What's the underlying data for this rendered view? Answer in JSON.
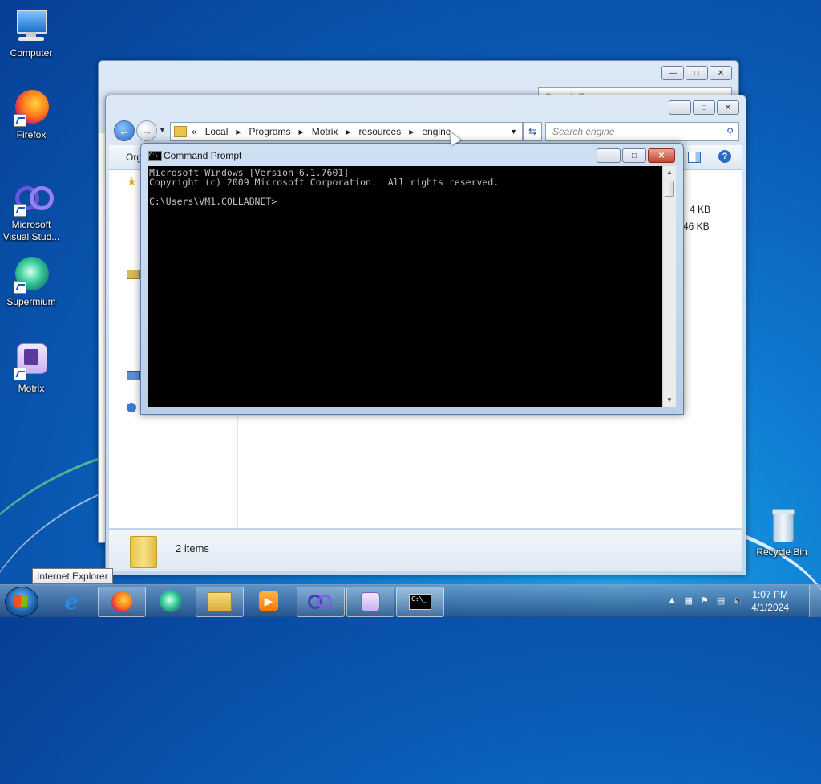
{
  "desktop": {
    "icons": [
      {
        "label": "Computer"
      },
      {
        "label": "Firefox"
      },
      {
        "label": "Microsoft Visual Stud..."
      },
      {
        "label": "Supermium"
      },
      {
        "label": "Motrix"
      },
      {
        "label": "Recycle Bin"
      }
    ]
  },
  "explorer_back": {
    "search_placeholder": "Search Resources"
  },
  "explorer": {
    "breadcrumb_chevron": "«",
    "path": [
      "Local",
      "Programs",
      "Motrix",
      "resources",
      "engine"
    ],
    "search_placeholder": "Search engine",
    "toolbar_organize": "Org",
    "file_sizes": [
      "4 KB",
      "46 KB"
    ],
    "status_items": "2 items"
  },
  "cmd": {
    "title": "Command Prompt",
    "line1": "Microsoft Windows [Version 6.1.7601]",
    "line2": "Copyright (c) 2009 Microsoft Corporation.  All rights reserved.",
    "line3": "",
    "line4": "C:\\Users\\VM1.COLLABNET>"
  },
  "tooltip": "Internet Explorer",
  "taskbar": {
    "items": [
      "internet-explorer",
      "firefox",
      "supermium",
      "windows-explorer",
      "media-player",
      "visual-studio",
      "motrix",
      "command-prompt"
    ],
    "time": "1:07 PM",
    "date": "4/1/2024"
  }
}
